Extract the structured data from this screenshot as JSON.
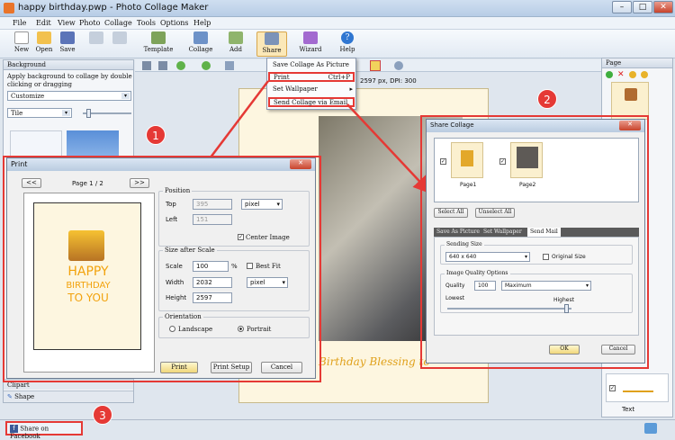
{
  "window": {
    "title": "happy birthday.pwp - Photo Collage Maker",
    "min": "–",
    "max": "□",
    "close": "✕"
  },
  "menu": [
    "File",
    "Edit",
    "View",
    "Photo",
    "Collage",
    "Tools",
    "Options",
    "Help"
  ],
  "toolbar": {
    "new": "New",
    "open": "Open",
    "save": "Save",
    "template": "Template",
    "collage": "Collage",
    "add": "Add",
    "share": "Share",
    "wizard": "Wizard",
    "help": "Help"
  },
  "share_menu": {
    "items": [
      "Save Collage As Picture",
      "Print",
      "Set Wallpaper",
      "Send Collage via Email"
    ],
    "print_shortcut": "Ctrl+P"
  },
  "left": {
    "header": "Background",
    "desc": "Apply background to collage by double clicking or dragging",
    "customize": "Customize",
    "tile": "Tile",
    "clipart": "Clipart",
    "shape": "Shape",
    "facebook": "Share on Facebook"
  },
  "canvas": {
    "info": "2597 px, DPI: 300",
    "blessing": "Birthday Blessing to"
  },
  "right": {
    "header": "Page",
    "text_label": "Text"
  },
  "badges": [
    "1",
    "2",
    "3"
  ],
  "print": {
    "title": "Print",
    "page": "Page 1 / 2",
    "prev": "<<",
    "next": ">>",
    "cake_l1": "HAPPY",
    "cake_l2": "BIRTHDAY",
    "cake_l3": "TO YOU",
    "position": "Position",
    "top": "Top",
    "top_val": "395",
    "left": "Left",
    "left_val": "151",
    "pos_unit": "pixel",
    "center": "Center Image",
    "size": "Size after Scale",
    "scale": "Scale",
    "scale_val": "100",
    "pct": "%",
    "best_fit": "Best Fit",
    "width": "Width",
    "width_val": "2032",
    "height": "Height",
    "height_val": "2597",
    "size_unit": "pixel",
    "orientation": "Orientation",
    "landscape": "Landscape",
    "portrait": "Portrait",
    "print_btn": "Print",
    "setup_btn": "Print Setup",
    "cancel_btn": "Cancel"
  },
  "share": {
    "title": "Share Collage",
    "page1": "Page1",
    "page2": "Page2",
    "select_all": "Select All",
    "unselect_all": "Unselect All",
    "tabs": [
      "Save As Picture",
      "Set Wallpaper",
      "Send Mail"
    ],
    "sending_size": "Sending Size",
    "size_val": "640 x 640",
    "original_size": "Original Size",
    "quality_opts": "Image Quality Options",
    "quality": "Quality",
    "quality_val": "100",
    "maximum": "Maximum",
    "lowest": "Lowest",
    "highest": "Highest",
    "ok": "OK",
    "cancel": "Cancel"
  },
  "colors": {
    "accent_red": "#e53935",
    "cake_orange": "#f2a20c"
  }
}
